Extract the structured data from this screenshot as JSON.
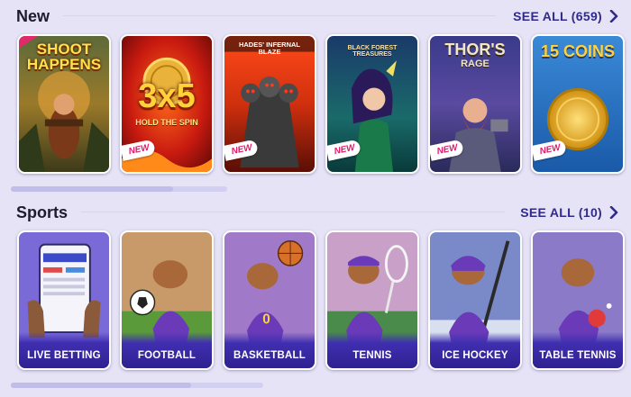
{
  "new_section": {
    "title": "New",
    "see_all": "SEE ALL (659)",
    "badge": "NEW",
    "games": [
      {
        "title": "SHOOT HAPPENS",
        "subtitle": "",
        "new": false
      },
      {
        "title": "3x5",
        "subtitle": "HOLD THE SPIN",
        "new": true
      },
      {
        "title": "HADES' INFERNAL BLAZE",
        "subtitle": "",
        "new": true
      },
      {
        "title": "BLACK FOREST TREASURES",
        "subtitle": "",
        "new": true
      },
      {
        "title": "THOR'S",
        "subtitle": "RAGE",
        "new": true
      },
      {
        "title": "15 COINS",
        "subtitle": "",
        "new": true
      }
    ]
  },
  "sports_section": {
    "title": "Sports",
    "see_all": "SEE ALL (10)",
    "items": [
      {
        "label": "LIVE BETTING"
      },
      {
        "label": "FOOTBALL"
      },
      {
        "label": "BASKETBALL"
      },
      {
        "label": "TENNIS"
      },
      {
        "label": "ICE HOCKEY"
      },
      {
        "label": "TABLE TENNIS"
      }
    ]
  },
  "colors": {
    "background": "#e6e3f7",
    "accent": "#2f2a8c",
    "badge": "#e5186a",
    "sport_label_bg": "#3f2fb0"
  }
}
